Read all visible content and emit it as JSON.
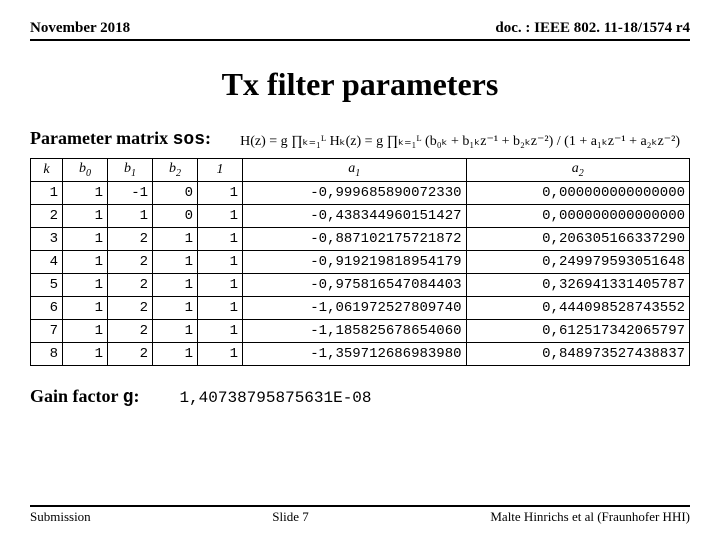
{
  "header": {
    "left": "November 2018",
    "right": "doc. : IEEE 802. 11-18/1574 r4"
  },
  "title": "Tx filter parameters",
  "param_label_prefix": "Parameter matrix ",
  "param_label_code": "sos",
  "param_label_suffix": ":",
  "formula_text": "H(z) = g ∏ₖ₌₁ᴸ Hₖ(z) = g ∏ₖ₌₁ᴸ (b₀ₖ + b₁ₖz⁻¹ + b₂ₖz⁻²) / (1 + a₁ₖz⁻¹ + a₂ₖz⁻²)",
  "columns": [
    "k",
    "b0",
    "b1",
    "b2",
    "1",
    "a1",
    "a2"
  ],
  "rows": [
    {
      "k": "1",
      "b0": "1",
      "b1": "-1",
      "b2": "0",
      "one": "1",
      "a1": "-0,999685890072330",
      "a2": "0,000000000000000"
    },
    {
      "k": "2",
      "b0": "1",
      "b1": "1",
      "b2": "0",
      "one": "1",
      "a1": "-0,438344960151427",
      "a2": "0,000000000000000"
    },
    {
      "k": "3",
      "b0": "1",
      "b1": "2",
      "b2": "1",
      "one": "1",
      "a1": "-0,887102175721872",
      "a2": "0,206305166337290"
    },
    {
      "k": "4",
      "b0": "1",
      "b1": "2",
      "b2": "1",
      "one": "1",
      "a1": "-0,919219818954179",
      "a2": "0,249979593051648"
    },
    {
      "k": "5",
      "b0": "1",
      "b1": "2",
      "b2": "1",
      "one": "1",
      "a1": "-0,975816547084403",
      "a2": "0,326941331405787"
    },
    {
      "k": "6",
      "b0": "1",
      "b1": "2",
      "b2": "1",
      "one": "1",
      "a1": "-1,061972527809740",
      "a2": "0,444098528743552"
    },
    {
      "k": "7",
      "b0": "1",
      "b1": "2",
      "b2": "1",
      "one": "1",
      "a1": "-1,185825678654060",
      "a2": "0,612517342065797"
    },
    {
      "k": "8",
      "b0": "1",
      "b1": "2",
      "b2": "1",
      "one": "1",
      "a1": "-1,359712686983980",
      "a2": "0,848973527438837"
    }
  ],
  "gain_label_prefix": "Gain factor ",
  "gain_label_code": "g",
  "gain_label_suffix": ":",
  "gain_value": "1,40738795875631E-08",
  "footer": {
    "left": "Submission",
    "center": "Slide 7",
    "right": "Malte Hinrichs et al (Fraunhofer HHI)"
  },
  "chart_data": {
    "type": "table",
    "title": "Tx filter parameters — sos matrix",
    "columns": [
      "k",
      "b0",
      "b1",
      "b2",
      "1",
      "a1",
      "a2"
    ],
    "rows": [
      [
        1,
        1,
        -1,
        0,
        1,
        -0.99968589007233,
        0.0
      ],
      [
        2,
        1,
        1,
        0,
        1,
        -0.438344960151427,
        0.0
      ],
      [
        3,
        1,
        2,
        1,
        1,
        -0.887102175721872,
        0.20630516633729
      ],
      [
        4,
        1,
        2,
        1,
        1,
        -0.919219818954179,
        0.249979593051648
      ],
      [
        5,
        1,
        2,
        1,
        1,
        -0.975816547084403,
        0.326941331405787
      ],
      [
        6,
        1,
        2,
        1,
        1,
        -1.06197252780974,
        0.444098528743552
      ],
      [
        7,
        1,
        2,
        1,
        1,
        -1.18582567865406,
        0.612517342065797
      ],
      [
        8,
        1,
        2,
        1,
        1,
        -1.35971268698398,
        0.848973527438837
      ]
    ],
    "gain_factor_g": 1.40738795875631e-08
  }
}
